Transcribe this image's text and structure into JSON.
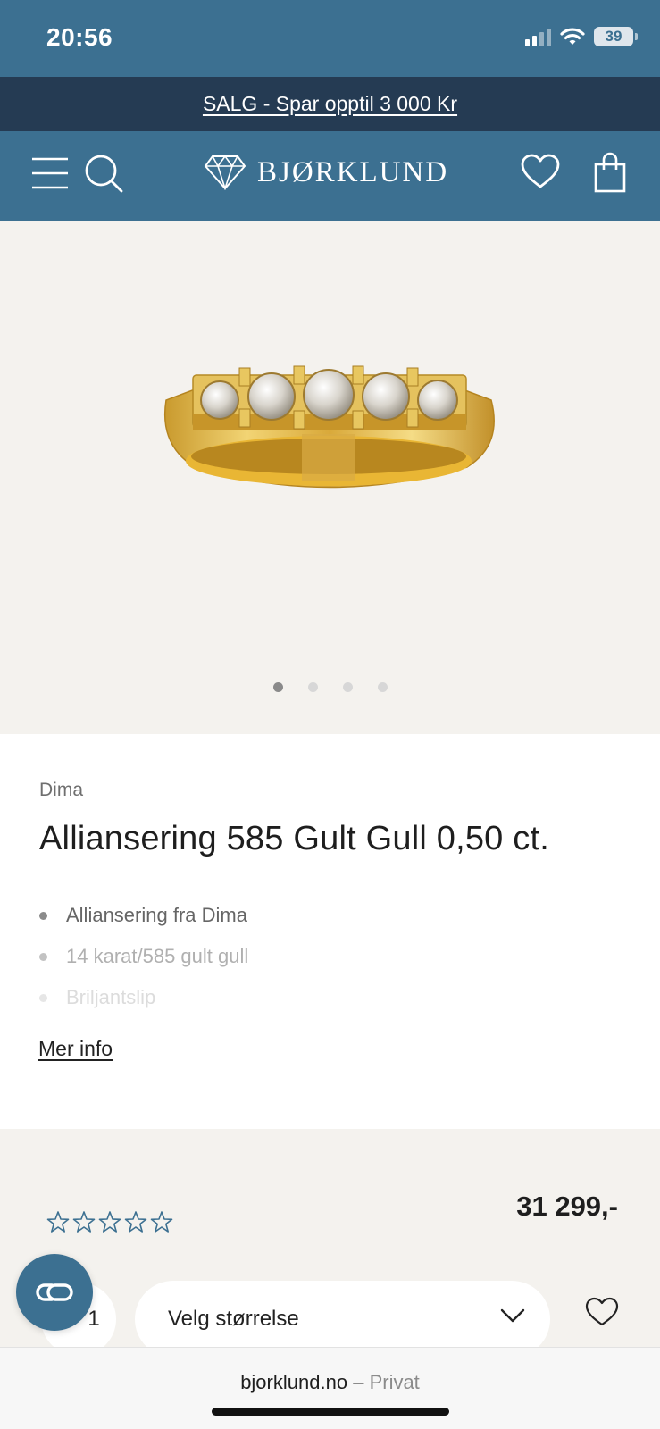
{
  "status": {
    "time": "20:56",
    "battery": "39"
  },
  "promo": {
    "text": "SALG - Spar opptil 3 000 Kr"
  },
  "header": {
    "logo_text": "BJØRKLUND"
  },
  "gallery": {
    "slide_count": 4,
    "active_slide": 1
  },
  "product": {
    "brand": "Dima",
    "title": "Alliansering 585 Gult Gull 0,50 ct.",
    "features": [
      "Alliansering fra Dima",
      "14 karat/585 gult gull",
      "Briljantslip"
    ],
    "more_info": "Mer info",
    "price": "31 299,-",
    "rating": {
      "filled": 0,
      "max": 5
    },
    "quantity": "1",
    "size_placeholder": "Velg størrelse"
  },
  "browser": {
    "domain": "bjorklund.no",
    "separator": "–",
    "mode": "Privat"
  },
  "colors": {
    "brand_blue": "#3c7091",
    "promo_navy": "#253b53",
    "gallery_bg": "#f4f2ee"
  },
  "icons": [
    "menu-icon",
    "search-icon",
    "diamond-logo-icon",
    "heart-icon",
    "shopping-bag-icon",
    "star-icon",
    "chevron-down-icon",
    "chat-icon"
  ]
}
